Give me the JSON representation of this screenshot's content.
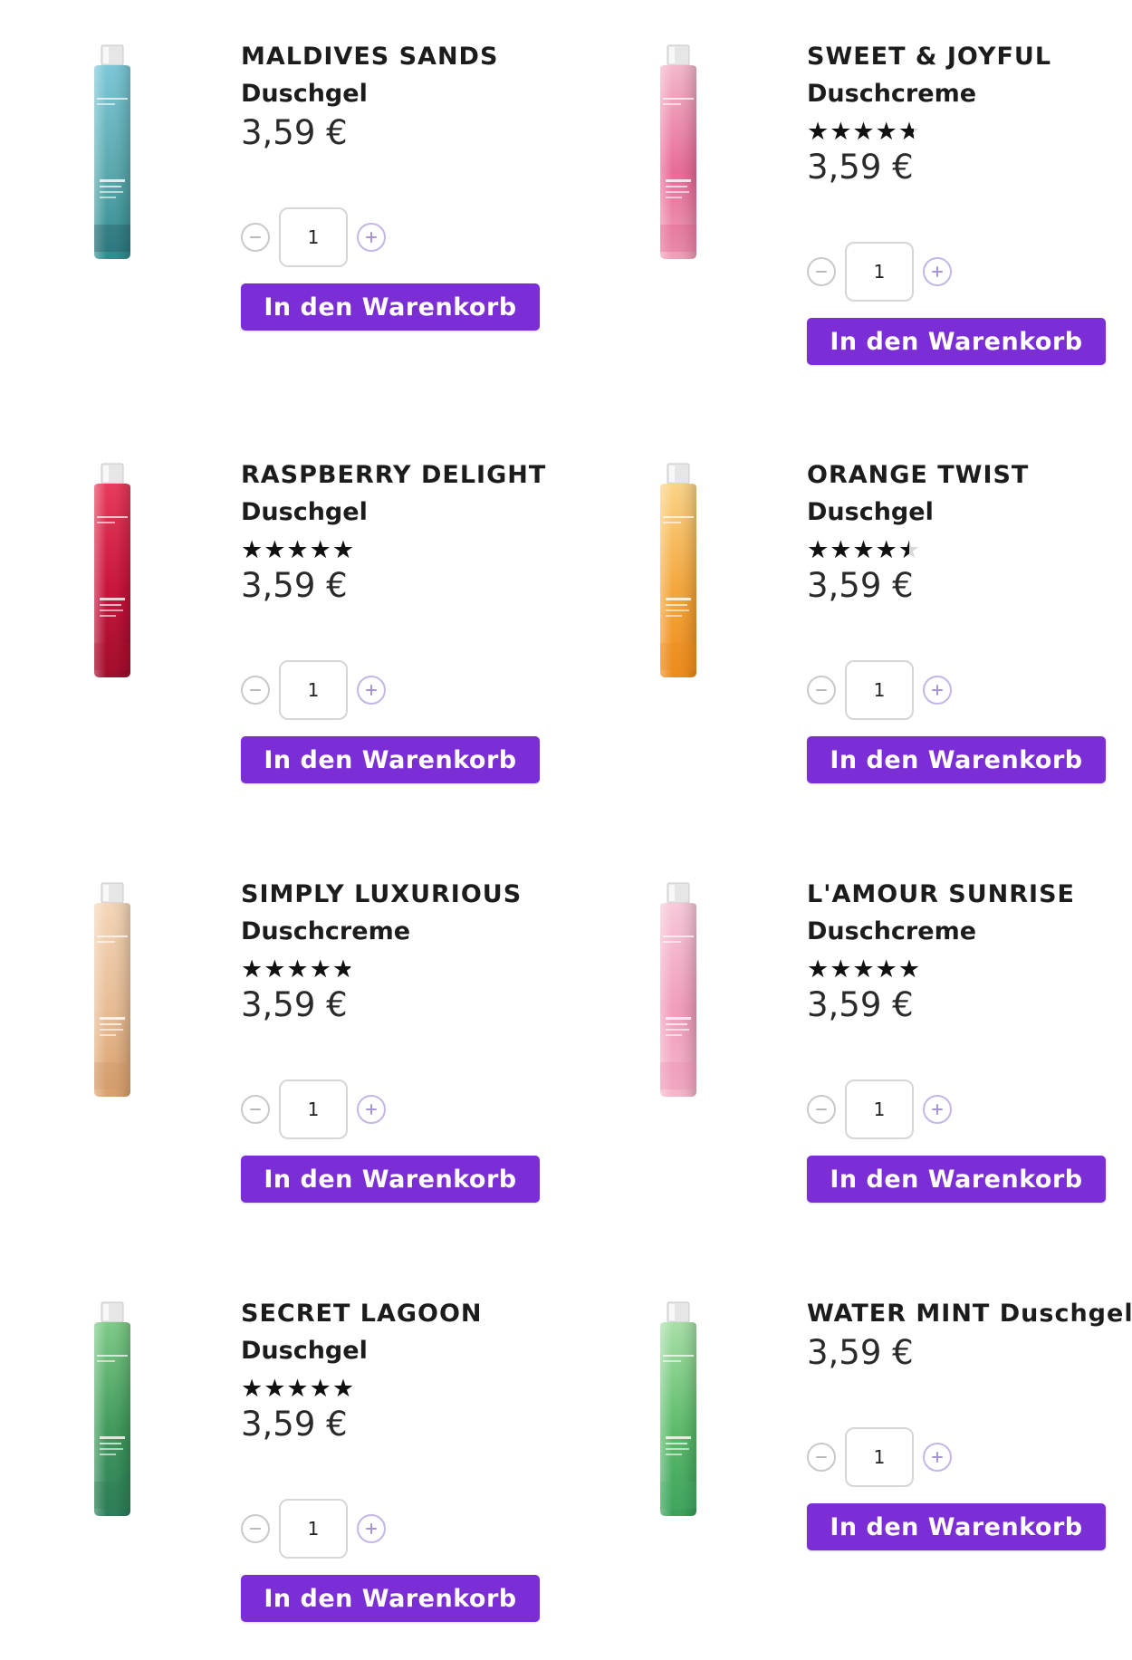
{
  "products": [
    {
      "name": "MALDIVES SANDS",
      "type": "Duschgel",
      "rating": null,
      "stars_text": "",
      "price": "3,59 €",
      "quantity": "1",
      "cart_label": "In den Warenkorb",
      "bottle": {
        "top": "#7cc7d8",
        "mid": "#59a9ad",
        "bottom": "#2f8a8e",
        "label": "#1c3a4a"
      }
    },
    {
      "name": "SWEET & JOYFUL",
      "type": "Duschcreme",
      "rating": 4.7,
      "stars_text": "★★★★★",
      "price": "3,59 €",
      "quantity": "1",
      "cart_label": "In den Warenkorb",
      "bottle": {
        "top": "#f4b8cc",
        "mid": "#e86a98",
        "bottom": "#f0a0b8",
        "label": "#d94d7f"
      }
    },
    {
      "name": "RASPBERRY DELIGHT",
      "type": "Duschgel",
      "rating": 5,
      "stars_text": "★★★★★",
      "price": "3,59 €",
      "quantity": "1",
      "cart_label": "In den Warenkorb",
      "bottle": {
        "top": "#e83a5a",
        "mid": "#c8123a",
        "bottom": "#9e0a2a",
        "label": "#b0102e"
      }
    },
    {
      "name": "ORANGE TWIST",
      "type": "Duschgel",
      "rating": 4.5,
      "stars_text": "★★★★★",
      "price": "3,59 €",
      "quantity": "1",
      "cart_label": "In den Warenkorb",
      "bottle": {
        "top": "#fbd488",
        "mid": "#f4a63a",
        "bottom": "#ef8b1a",
        "label": "#e7891c"
      }
    },
    {
      "name": "SIMPLY LUXURIOUS",
      "type": "Duschcreme",
      "rating": 4.8,
      "stars_text": "★★★★★",
      "price": "3,59 €",
      "quantity": "1",
      "cart_label": "In den Warenkorb",
      "bottle": {
        "top": "#f4d6b8",
        "mid": "#e8bc94",
        "bottom": "#d9a06a",
        "label": "#c99068"
      }
    },
    {
      "name": "L'AMOUR SUNRISE",
      "type": "Duschcreme",
      "rating": 5,
      "stars_text": "★★★★★",
      "price": "3,59 €",
      "quantity": "1",
      "cart_label": "In den Warenkorb",
      "bottle": {
        "top": "#f8c9da",
        "mid": "#f19cbc",
        "bottom": "#f6b6cb",
        "label": "#e781a8"
      }
    },
    {
      "name": "SECRET LAGOON",
      "type": "Duschgel",
      "rating": 5,
      "stars_text": "★★★★★",
      "price": "3,59 €",
      "quantity": "1",
      "cart_label": "In den Warenkorb",
      "bottle": {
        "top": "#7ecb88",
        "mid": "#3f9a5a",
        "bottom": "#2b7c5a",
        "label": "#2f7a4a"
      }
    },
    {
      "name": "WATER MINT Duschgel",
      "type": "",
      "rating": null,
      "stars_text": "",
      "price": "3,59 €",
      "quantity": "1",
      "cart_label": "In den Warenkorb",
      "bottle": {
        "top": "#a8e0a8",
        "mid": "#5cbc6a",
        "bottom": "#3aa05a",
        "label": "#4cae66"
      }
    }
  ],
  "colors": {
    "button": "#7b2dd6",
    "button_text": "#ffffff",
    "star": "#111111",
    "price": "#2a2a2a"
  },
  "icons": {
    "minus": "minus-circle-icon",
    "plus": "plus-circle-icon"
  }
}
